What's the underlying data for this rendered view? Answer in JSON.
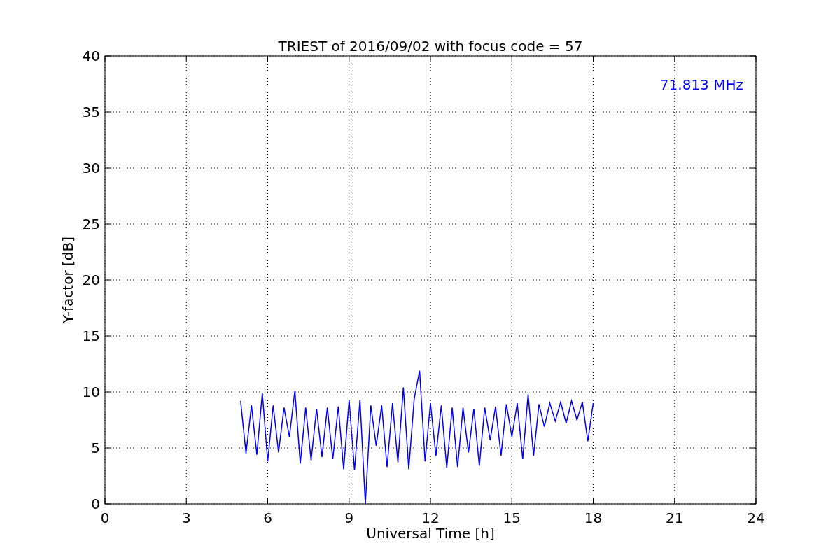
{
  "chart_data": {
    "type": "line",
    "title": "TRIEST of 2016/09/02 with focus code = 57",
    "xlabel": "Universal Time [h]",
    "ylabel": "Y-factor [dB]",
    "x": [
      5.0,
      5.2,
      5.4,
      5.6,
      5.8,
      6.0,
      6.2,
      6.4,
      6.6,
      6.8,
      7.0,
      7.2,
      7.4,
      7.6,
      7.8,
      8.0,
      8.2,
      8.4,
      8.6,
      8.8,
      9.0,
      9.2,
      9.4,
      9.6,
      9.8,
      10.0,
      10.2,
      10.4,
      10.6,
      10.8,
      11.0,
      11.2,
      11.4,
      11.6,
      11.8,
      12.0,
      12.2,
      12.4,
      12.6,
      12.8,
      13.0,
      13.2,
      13.4,
      13.6,
      13.8,
      14.0,
      14.2,
      14.4,
      14.6,
      14.8,
      15.0,
      15.2,
      15.4,
      15.6,
      15.8,
      16.0,
      16.2,
      16.4,
      16.6,
      16.8,
      17.0,
      17.2,
      17.4,
      17.6,
      17.8,
      18.0
    ],
    "series": [
      {
        "name": "71.813 MHz",
        "color": "#0000ff",
        "values": [
          9.2,
          4.5,
          8.8,
          4.4,
          9.9,
          3.8,
          8.8,
          4.6,
          8.6,
          6.0,
          10.1,
          3.6,
          8.6,
          3.9,
          8.5,
          4.2,
          8.6,
          4.0,
          8.7,
          3.1,
          9.3,
          3.0,
          9.3,
          0.0,
          8.8,
          5.2,
          8.8,
          3.3,
          9.0,
          3.7,
          10.4,
          3.1,
          9.4,
          11.9,
          3.8,
          9.0,
          4.3,
          8.8,
          3.2,
          8.6,
          3.3,
          8.6,
          4.6,
          8.5,
          3.4,
          8.6,
          5.7,
          8.7,
          4.3,
          8.9,
          6.0,
          9.0,
          4.0,
          9.8,
          4.3,
          8.9,
          6.9,
          9.0,
          7.4,
          9.1,
          7.2,
          9.2,
          7.5,
          9.1,
          5.6,
          9.0
        ]
      }
    ],
    "xlim": [
      0,
      24
    ],
    "ylim": [
      0,
      40
    ],
    "xticks": [
      0,
      3,
      6,
      9,
      12,
      15,
      18,
      21,
      24
    ],
    "yticks": [
      0,
      5,
      10,
      15,
      20,
      25,
      30,
      35,
      40
    ],
    "grid": true
  }
}
